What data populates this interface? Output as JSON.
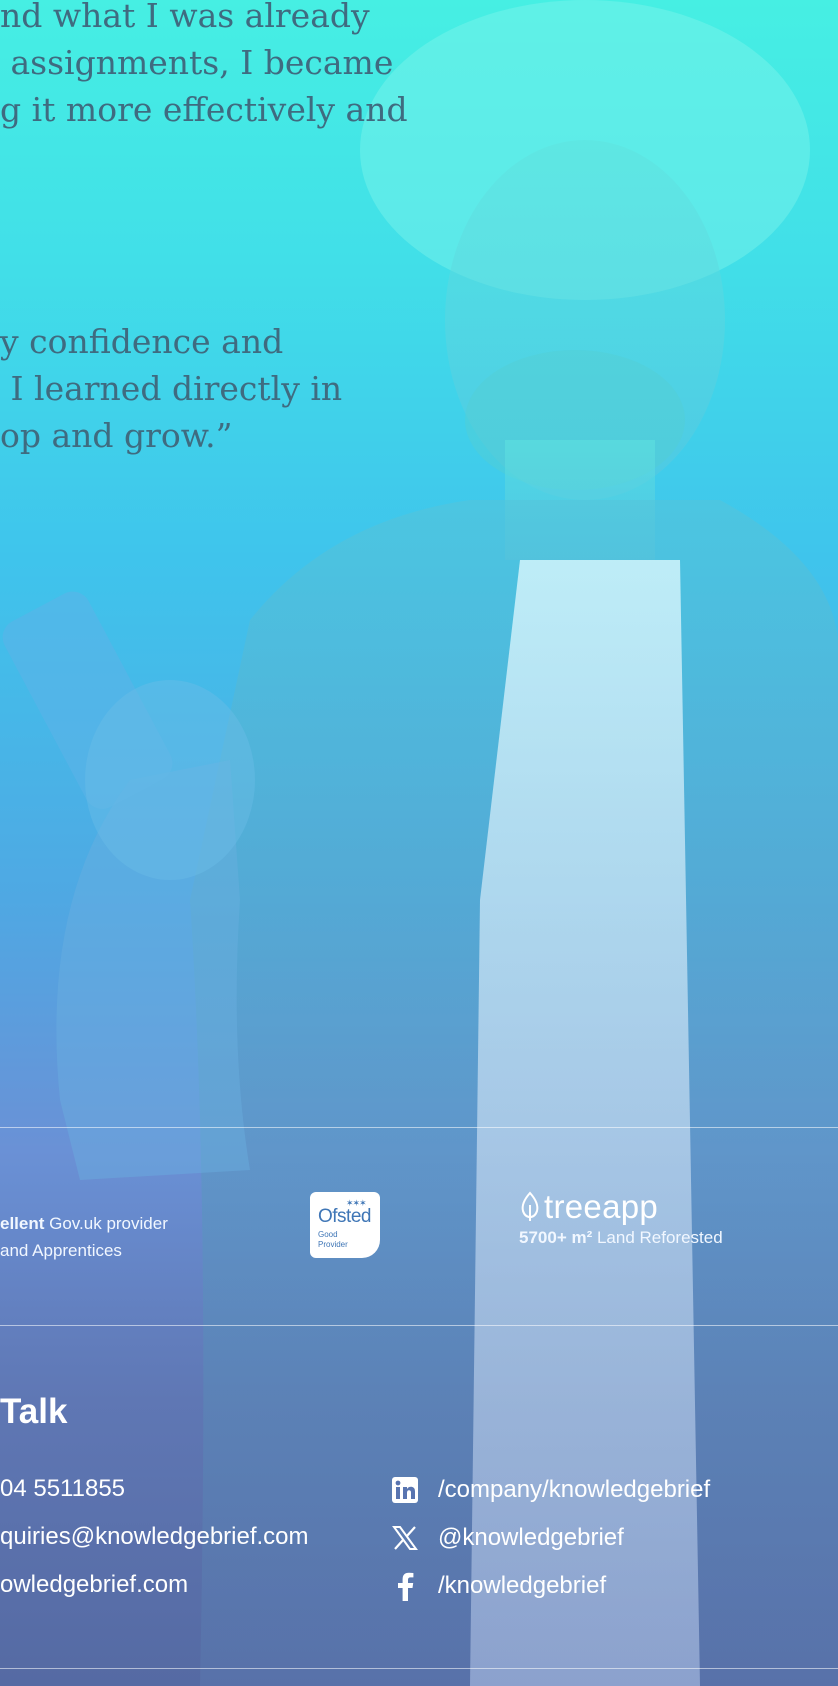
{
  "testimonial": {
    "lines_block1": [
      "nd what I was already",
      " assignments, I became",
      "g it more effectively and"
    ],
    "lines_block2": [
      "y confidence and",
      " I learned directly in",
      "op and grow.”"
    ]
  },
  "accreditations": {
    "govuk": {
      "bold": "ellent",
      "rest": " Gov.uk provider",
      "line2": "and Apprentices"
    },
    "ofsted": {
      "word": "Ofsted",
      "sub_line1": "Good",
      "sub_line2": "Provider"
    },
    "treeapp": {
      "logo": "treeapp",
      "stat_bold": "5700+ m²",
      "stat_rest": " Land Reforested"
    }
  },
  "contact": {
    "heading": "Talk",
    "phone": "04 5511855",
    "email": "quiries@knowledgebrief.com",
    "website": "owledgebrief.com"
  },
  "social": {
    "linkedin": {
      "label": "/company/knowledgebrief",
      "icon": "linkedin-icon"
    },
    "x": {
      "label": "@knowledgebrief",
      "icon": "x-icon"
    },
    "facebook": {
      "label": "/knowledgebrief",
      "icon": "facebook-icon"
    }
  },
  "colors": {
    "gradient_top": "#46efe3",
    "gradient_bottom": "#556aa3",
    "quote_text": "#3f6b80",
    "ofsted_blue": "#3f76b6"
  }
}
